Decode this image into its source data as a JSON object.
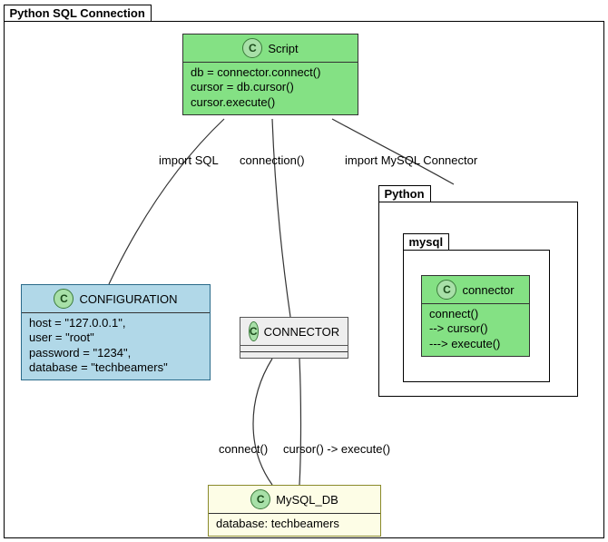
{
  "packages": {
    "root": "Python SQL Connection",
    "python": "Python",
    "mysql": "mysql"
  },
  "nodes": {
    "script": {
      "title": "Script",
      "body": "db = connector.connect()\ncursor = db.cursor()\ncursor.execute()"
    },
    "configuration": {
      "title": "CONFIGURATION",
      "body": "host = \"127.0.0.1\",\nuser = \"root\"\npassword = \"1234\",\ndatabase = \"techbeamers\""
    },
    "connector": {
      "title": "CONNECTOR"
    },
    "connector_mod": {
      "title": "connector",
      "body": "connect()\n--> cursor()\n---> execute()"
    },
    "mysql_db": {
      "title": "MySQL_DB",
      "body": "database: techbeamers"
    }
  },
  "edges": {
    "import_sql": "import SQL",
    "connection": "connection()",
    "import_mysql": "import MySQL Connector",
    "connect": "connect()",
    "cursor_execute": "cursor() -> execute()"
  }
}
